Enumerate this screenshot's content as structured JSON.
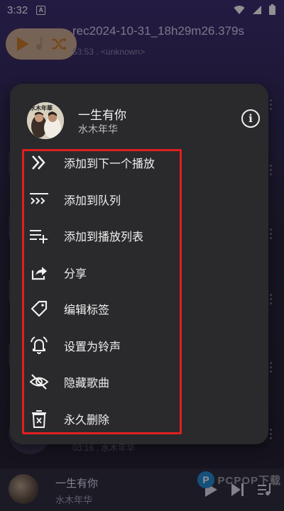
{
  "status_bar": {
    "time": "3:32",
    "notification_badge": "A",
    "icons": [
      "wifi-icon",
      "signal-icon",
      "battery-icon"
    ]
  },
  "background": {
    "fab_icons": [
      "play-icon",
      "music-note-icon",
      "shuffle-icon"
    ],
    "track": {
      "title": "rec2024-10-31_18h29m26.379s",
      "duration": "53:53",
      "artist": "<unknown>"
    },
    "bottom_track": {
      "duration": "03:16",
      "artist": "水木年华"
    }
  },
  "menu": {
    "song_title": "一生有你",
    "song_artist": "水木年华",
    "cover_text": "水木年華",
    "info_icon": "info-icon",
    "items": [
      {
        "label": "添加到下一个播放",
        "icon": "play-next-icon"
      },
      {
        "label": "添加到队列",
        "icon": "add-to-queue-icon"
      },
      {
        "label": "添加到播放列表",
        "icon": "add-to-playlist-icon"
      },
      {
        "label": "分享",
        "icon": "share-icon"
      },
      {
        "label": "编辑标签",
        "icon": "tag-icon"
      },
      {
        "label": "设置为铃声",
        "icon": "bell-icon"
      },
      {
        "label": "隐藏歌曲",
        "icon": "hide-icon"
      },
      {
        "label": "永久删除",
        "icon": "delete-icon"
      }
    ],
    "highlight_color": "#e0201e"
  },
  "mini_player": {
    "title": "一生有你",
    "artist": "水木年华",
    "controls": [
      "play-icon",
      "skip-next-icon",
      "queue-icon"
    ]
  },
  "watermark": {
    "text": "PCPOP下载"
  }
}
